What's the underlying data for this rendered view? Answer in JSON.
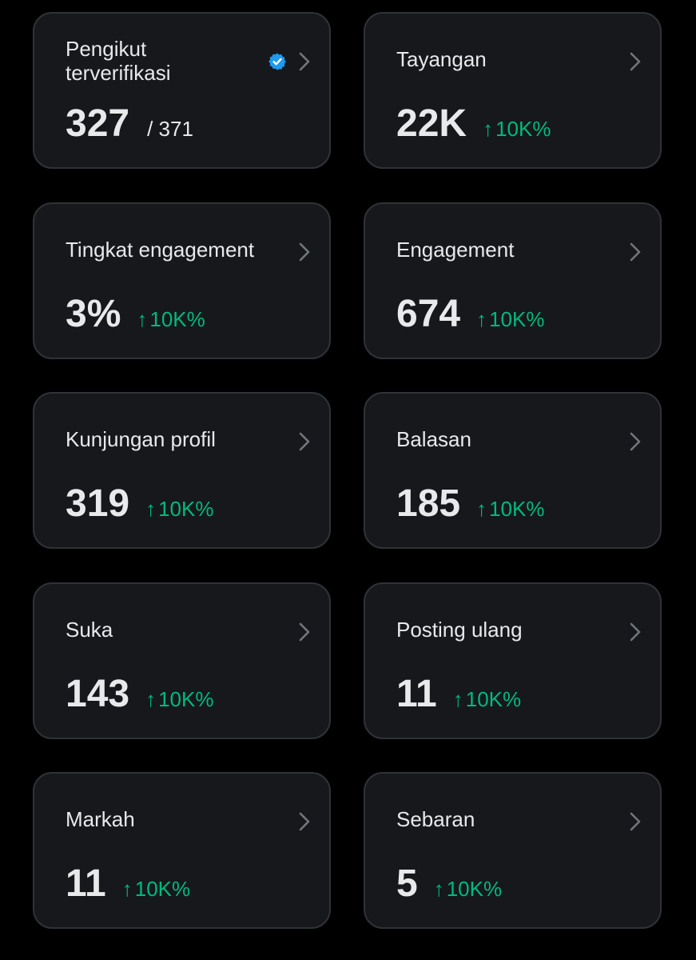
{
  "colors": {
    "background": "#000000",
    "card": "#16181c",
    "card_border": "#2f3336",
    "text": "#e7e9ea",
    "positive": "#00ba7c",
    "verified_badge": "#1d9bf0",
    "chevron": "#71767b"
  },
  "cards": [
    {
      "label": "Pengikut terverifikasi",
      "value": "327",
      "secondary": "/ 371",
      "icon": "verified-badge-icon"
    },
    {
      "label": "Tayangan",
      "value": "22K",
      "arrow": "↑",
      "delta": "10K%"
    },
    {
      "label": "Tingkat engagement",
      "value": "3%",
      "arrow": "↑",
      "delta": "10K%"
    },
    {
      "label": "Engagement",
      "value": "674",
      "arrow": "↑",
      "delta": "10K%"
    },
    {
      "label": "Kunjungan profil",
      "value": "319",
      "arrow": "↑",
      "delta": "10K%"
    },
    {
      "label": "Balasan",
      "value": "185",
      "arrow": "↑",
      "delta": "10K%"
    },
    {
      "label": "Suka",
      "value": "143",
      "arrow": "↑",
      "delta": "10K%"
    },
    {
      "label": "Posting ulang",
      "value": "11",
      "arrow": "↑",
      "delta": "10K%"
    },
    {
      "label": "Markah",
      "value": "11",
      "arrow": "↑",
      "delta": "10K%"
    },
    {
      "label": "Sebaran",
      "value": "5",
      "arrow": "↑",
      "delta": "10K%"
    }
  ]
}
